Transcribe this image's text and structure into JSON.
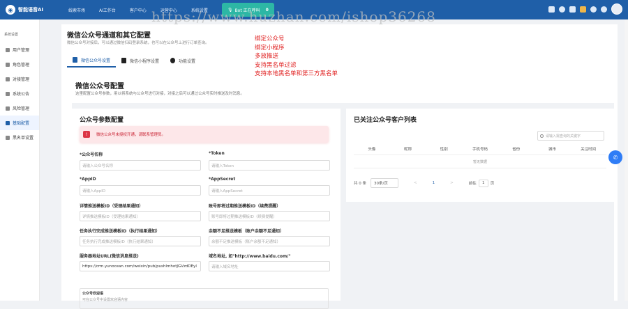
{
  "topbar": {
    "logo_text": "智能语音AI",
    "nav": [
      "线索市场",
      "AI工作台",
      "客户中心",
      "运营中心",
      "系统设置"
    ],
    "call_status": "Bot 正在呼叫",
    "call_count": "0"
  },
  "sidebar": {
    "title": "系统设置",
    "items": [
      "用户管理",
      "角色管理",
      "对接管理",
      "系统公告",
      "风险管理",
      "基础配置",
      "黑名单设置"
    ]
  },
  "page": {
    "title": "微信公众号通道和其它配置",
    "desc": "微信公众号对接后，可以通过微信扫码登录系统，也可以在公众号上进行订单查询。",
    "tabs": [
      "微信公众号设置",
      "微信小程序设置",
      "功能设置"
    ]
  },
  "section": {
    "title": "微信公众号配置",
    "desc": "这里配置公众号参数，用以将系统与公众号进行对接，对接之后可以通过公众号实时推送及时消息。"
  },
  "left": {
    "title": "公众号参数配置",
    "alert": "微信公众号未授权开通，请联系管理员。",
    "fields": [
      {
        "label": "*公众号名称",
        "value": "请输入公众号名称"
      },
      {
        "label": "*Token",
        "value": "请输入Token"
      },
      {
        "label": "*AppID",
        "value": "请输入AppID"
      },
      {
        "label": "*AppSecret",
        "value": "请输入AppSecret"
      },
      {
        "label": "详情推送模板ID（受理结果通知）",
        "value": "详情推送模板ID（受理结果通知）"
      },
      {
        "label": "账号即将过期推送模板ID（续费提醒）",
        "value": "账号即将过期推送模板ID（续费提醒）"
      },
      {
        "label": "任务执行完成推送模板ID（执行结果通知）",
        "value": "任务执行完成推送模板ID（执行结果通知）"
      },
      {
        "label": "余额不足推送模板（账户余额不足通知）",
        "value": "余额不足推送模板（账户余额不足通知）"
      },
      {
        "label": "服务器地址URL(微信消息推送)",
        "value": "https://crm.yunocean.com/weixin/pub/pushImhotJGVzdDEyl"
      },
      {
        "label": "域名地址, 如\"http://www.baidu.com/\"",
        "value": "请输入域名地址"
      }
    ],
    "template_box": {
      "title": "公众号欢迎语",
      "sub": "可在公众号中设置欢迎语内容"
    }
  },
  "right": {
    "title": "已关注公众号客户列表",
    "search_placeholder": "请输入需查询的关键字",
    "columns": [
      "头像",
      "昵称",
      "性别",
      "手机号码",
      "省份",
      "城市",
      "关注时间"
    ],
    "empty": "暂无数据",
    "pager": {
      "total": "共 0 条",
      "size": "30条/页",
      "prev": "<",
      "page": "1",
      "next": ">",
      "goto_label": "前往",
      "goto_value": "1",
      "goto_unit": "页"
    }
  },
  "overlay": {
    "watermark": "https://www.huzhan.com/ishop36268",
    "features": [
      "绑定公众号",
      "绑定小程序",
      "多放推送",
      "支持黑名单过滤",
      "支持本地黑名单和第三方黑名单"
    ]
  }
}
